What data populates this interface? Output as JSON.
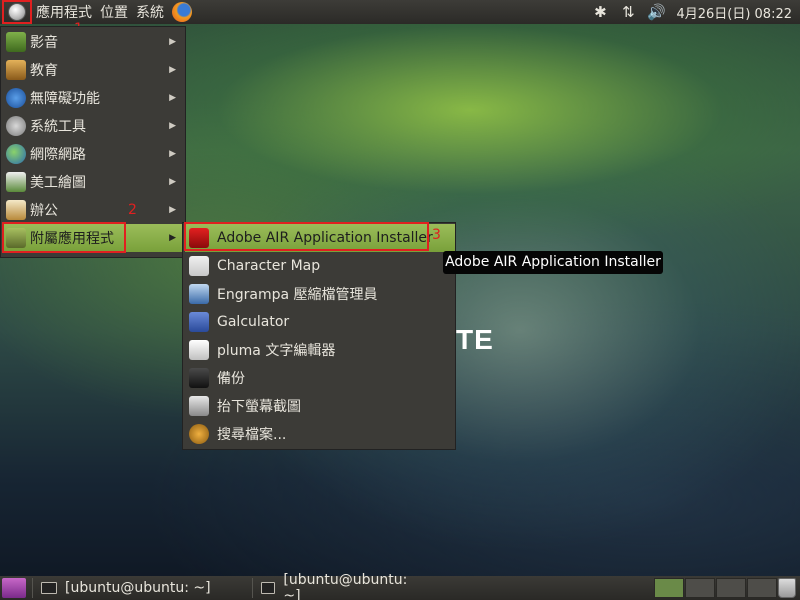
{
  "top_panel": {
    "menus": [
      "應用程式",
      "位置",
      "系統"
    ],
    "clock": "4月26日(日) 08:22"
  },
  "steps": [
    "1",
    "2",
    "3"
  ],
  "main_menu": {
    "items": [
      {
        "label": "影音",
        "icon": "audio-video-icon"
      },
      {
        "label": "教育",
        "icon": "education-icon"
      },
      {
        "label": "無障礙功能",
        "icon": "accessibility-icon"
      },
      {
        "label": "系統工具",
        "icon": "system-tools-icon"
      },
      {
        "label": "網際網路",
        "icon": "internet-icon"
      },
      {
        "label": "美工繪圖",
        "icon": "graphics-icon"
      },
      {
        "label": "辦公",
        "icon": "office-icon"
      },
      {
        "label": "附屬應用程式",
        "icon": "accessories-icon"
      }
    ]
  },
  "sub_menu": {
    "items": [
      {
        "label": "Adobe AIR Application Installer",
        "icon": "adobe-air-icon"
      },
      {
        "label": "Character Map",
        "icon": "character-map-icon"
      },
      {
        "label": "Engrampa 壓縮檔管理員",
        "icon": "engrampa-icon"
      },
      {
        "label": "Galculator",
        "icon": "calculator-icon"
      },
      {
        "label": "pluma 文字編輯器",
        "icon": "text-editor-icon"
      },
      {
        "label": "備份",
        "icon": "backup-icon"
      },
      {
        "label": "抬下螢幕截圖",
        "icon": "screenshot-icon"
      },
      {
        "label": "搜尋檔案...",
        "icon": "search-files-icon"
      }
    ]
  },
  "tooltip": "Adobe AIR Application Installer",
  "desktop_text": "TE",
  "taskbar": {
    "tasks": [
      "[ubuntu@ubuntu: ~]",
      "[ubuntu@ubuntu: ~]"
    ]
  }
}
